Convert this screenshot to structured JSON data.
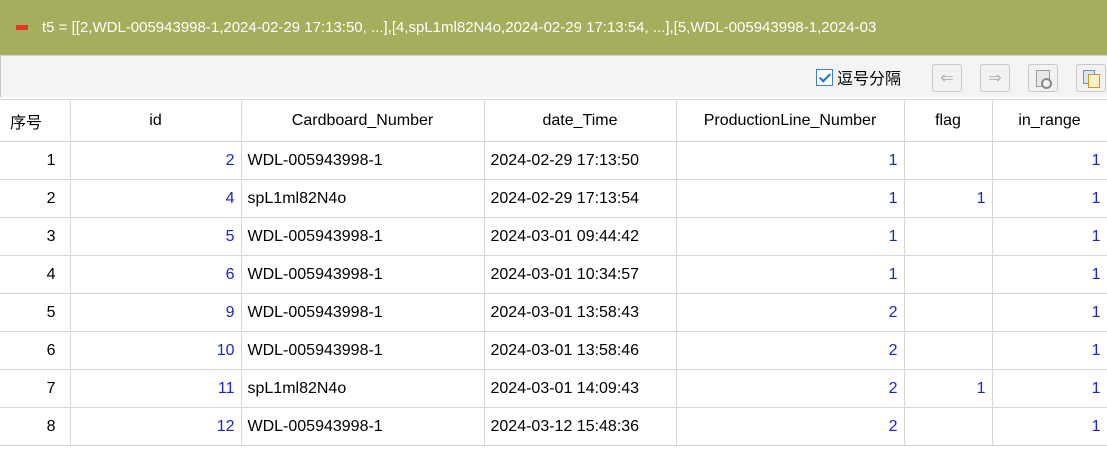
{
  "title_bar": {
    "text": "t5 = [[2,WDL-005943998-1,2024-02-29 17:13:50, ...],[4,spL1ml82N4o,2024-02-29 17:13:54, ...],[5,WDL-005943998-1,2024-03"
  },
  "toolbar": {
    "comma_separated_label": "逗号分隔",
    "comma_separated_checked": true,
    "prev_glyph": "⇐",
    "next_glyph": "⇒"
  },
  "table": {
    "headers": [
      "序号",
      "id",
      "Cardboard_Number",
      "date_Time",
      "ProductionLine_Number",
      "flag",
      "in_range"
    ],
    "rows": [
      {
        "idx": "1",
        "id": "2",
        "cardboard": "WDL-005943998-1",
        "date": "2024-02-29 17:13:50",
        "line": "1",
        "flag": "",
        "in_range": "1"
      },
      {
        "idx": "2",
        "id": "4",
        "cardboard": "spL1ml82N4o",
        "date": "2024-02-29 17:13:54",
        "line": "1",
        "flag": "1",
        "in_range": "1"
      },
      {
        "idx": "3",
        "id": "5",
        "cardboard": "WDL-005943998-1",
        "date": "2024-03-01 09:44:42",
        "line": "1",
        "flag": "",
        "in_range": "1"
      },
      {
        "idx": "4",
        "id": "6",
        "cardboard": "WDL-005943998-1",
        "date": "2024-03-01 10:34:57",
        "line": "1",
        "flag": "",
        "in_range": "1"
      },
      {
        "idx": "5",
        "id": "9",
        "cardboard": "WDL-005943998-1",
        "date": "2024-03-01 13:58:43",
        "line": "2",
        "flag": "",
        "in_range": "1"
      },
      {
        "idx": "6",
        "id": "10",
        "cardboard": "WDL-005943998-1",
        "date": "2024-03-01 13:58:46",
        "line": "2",
        "flag": "",
        "in_range": "1"
      },
      {
        "idx": "7",
        "id": "11",
        "cardboard": "spL1ml82N4o",
        "date": "2024-03-01 14:09:43",
        "line": "2",
        "flag": "1",
        "in_range": "1"
      },
      {
        "idx": "8",
        "id": "12",
        "cardboard": "WDL-005943998-1",
        "date": "2024-03-12 15:48:36",
        "line": "2",
        "flag": "",
        "in_range": "1"
      }
    ]
  },
  "colors": {
    "title_bar_bg": "#a4ae5c",
    "collapse_icon": "#e8342a",
    "number_blue": "#1a22d6",
    "grid_line": "#d7d7d7"
  }
}
